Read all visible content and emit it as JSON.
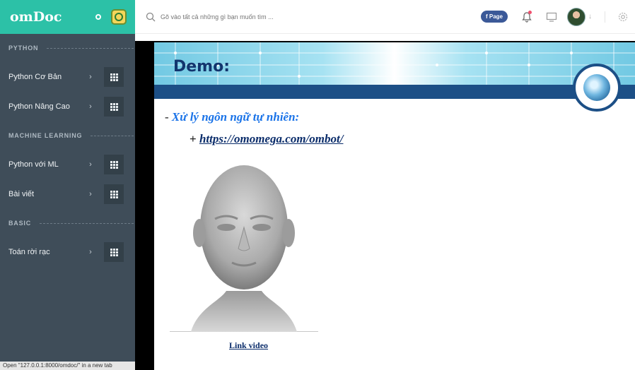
{
  "sidebar": {
    "brand": "omDoc",
    "sections": [
      {
        "title": "PYTHON",
        "items": [
          {
            "label": "Python Cơ Bản"
          },
          {
            "label": "Python Nâng Cao"
          }
        ]
      },
      {
        "title": "MACHINE LEARNING",
        "items": [
          {
            "label": "Python với ML"
          },
          {
            "label": "Bài viết"
          }
        ]
      },
      {
        "title": "BASIC",
        "items": [
          {
            "label": "Toán rời rạc"
          }
        ]
      }
    ],
    "status_text": "Open \"127.0.0.1:8000/omdoc/\" in a new tab"
  },
  "topbar": {
    "search_placeholder": "Gõ vào tất cả những gì bạn muốn tìm ...",
    "fb_page_label": "Page",
    "notification_badge_color": "#f0506e"
  },
  "slide": {
    "title": "Demo:",
    "bullet1_dash": "- ",
    "bullet1_text": "Xử lý ngôn ngữ tự nhiên:",
    "bullet2_plus": "+ ",
    "bullet2_link": "https://omomega.com/ombot/",
    "link_video": "Link video"
  },
  "colors": {
    "brand": "#2cc1a7",
    "sidebar": "#3f4d59",
    "slide_navy": "#1c4f86",
    "slide_accent": "#1a73e8"
  }
}
